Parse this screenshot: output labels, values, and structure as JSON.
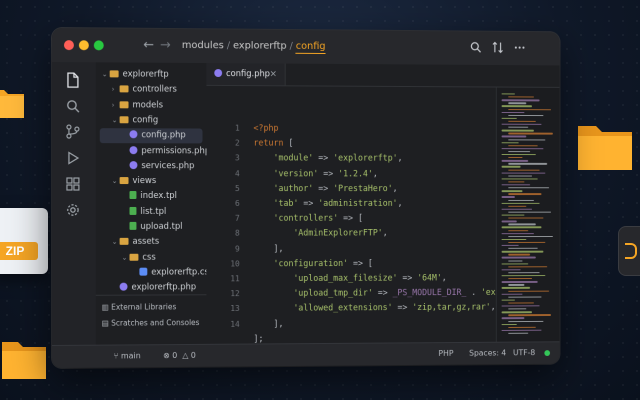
{
  "titlebar": {
    "breadcrumb": [
      "modules",
      "explorerftp",
      "config"
    ],
    "separator": "/"
  },
  "sidebar": {
    "items": [
      {
        "label": "explorerftp",
        "kind": "folder",
        "depth": 0,
        "open": true
      },
      {
        "label": "controllers",
        "kind": "folder",
        "depth": 1,
        "open": false
      },
      {
        "label": "models",
        "kind": "folder",
        "depth": 1,
        "open": false
      },
      {
        "label": "config",
        "kind": "folder",
        "depth": 1,
        "open": true
      },
      {
        "label": "config.php",
        "kind": "php",
        "depth": 2,
        "selected": true
      },
      {
        "label": "permissions.php",
        "kind": "php",
        "depth": 2
      },
      {
        "label": "services.php",
        "kind": "php",
        "depth": 2
      },
      {
        "label": "views",
        "kind": "folder",
        "depth": 1,
        "open": true
      },
      {
        "label": "index.tpl",
        "kind": "tpl",
        "depth": 2
      },
      {
        "label": "list.tpl",
        "kind": "tpl",
        "depth": 2
      },
      {
        "label": "upload.tpl",
        "kind": "tpl",
        "depth": 2
      },
      {
        "label": "assets",
        "kind": "folder",
        "depth": 1,
        "open": true
      },
      {
        "label": "css",
        "kind": "folder",
        "depth": 2,
        "open": true
      },
      {
        "label": "explorerftp.css",
        "kind": "css",
        "depth": 3
      },
      {
        "label": "explorerftp.php",
        "kind": "php",
        "depth": 1
      }
    ],
    "footer": {
      "external_libraries": "External Libraries",
      "scratches": "Scratches and Consoles"
    }
  },
  "editor": {
    "tab_label": "config.php",
    "tab_close": "×",
    "line_numbers": [
      "1",
      "2",
      "3",
      "4",
      "5",
      "6",
      "7",
      "8",
      "9",
      "10",
      "11",
      "12",
      "13",
      "14"
    ],
    "code": [
      [
        {
          "t": "<?php",
          "c": "kw"
        }
      ],
      [
        {
          "t": "return",
          "c": "kw"
        },
        {
          "t": " [",
          "c": "op"
        }
      ],
      [
        {
          "t": "    'module'",
          "c": "str"
        },
        {
          "t": " => ",
          "c": "op"
        },
        {
          "t": "'explorerftp'",
          "c": "str"
        },
        {
          "t": ",",
          "c": "op"
        }
      ],
      [
        {
          "t": "    'version'",
          "c": "str"
        },
        {
          "t": " => ",
          "c": "op"
        },
        {
          "t": "'1.2.4'",
          "c": "str"
        },
        {
          "t": ",",
          "c": "op"
        }
      ],
      [
        {
          "t": "    'author'",
          "c": "str"
        },
        {
          "t": " => ",
          "c": "op"
        },
        {
          "t": "'PrestaHero'",
          "c": "str"
        },
        {
          "t": ",",
          "c": "op"
        }
      ],
      [
        {
          "t": "    'tab'",
          "c": "str"
        },
        {
          "t": " => ",
          "c": "op"
        },
        {
          "t": "'administration'",
          "c": "str"
        },
        {
          "t": ",",
          "c": "op"
        }
      ],
      [
        {
          "t": "    'controllers'",
          "c": "str"
        },
        {
          "t": " => [",
          "c": "op"
        }
      ],
      [
        {
          "t": "        'AdminExplorerFTP'",
          "c": "str"
        },
        {
          "t": ",",
          "c": "op"
        }
      ],
      [
        {
          "t": "    ],",
          "c": "op"
        }
      ],
      [
        {
          "t": "    'configuration'",
          "c": "str"
        },
        {
          "t": " => [",
          "c": "op"
        }
      ],
      [
        {
          "t": "        'upload_max_filesize'",
          "c": "str"
        },
        {
          "t": " => ",
          "c": "op"
        },
        {
          "t": "'64M'",
          "c": "str"
        },
        {
          "t": ",",
          "c": "op"
        }
      ],
      [
        {
          "t": "        'upload_tmp_dir'",
          "c": "str"
        },
        {
          "t": " => ",
          "c": "op"
        },
        {
          "t": "_PS_MODULE_DIR_",
          "c": "const"
        },
        {
          "t": " . ",
          "c": "op"
        },
        {
          "t": "'explorerftp/tmp/'",
          "c": "str"
        },
        {
          "t": ",",
          "c": "op"
        }
      ],
      [
        {
          "t": "        'allowed_extensions'",
          "c": "str"
        },
        {
          "t": " => ",
          "c": "op"
        },
        {
          "t": "'zip,tar,gz,rar'",
          "c": "str"
        },
        {
          "t": ",",
          "c": "op"
        }
      ],
      [
        {
          "t": "    ],",
          "c": "op"
        }
      ],
      [
        {
          "t": "];",
          "c": "op"
        }
      ]
    ]
  },
  "statusbar": {
    "branch": "main",
    "errors": "0",
    "warnings": "0",
    "language": "PHP",
    "indent": "Spaces: 4",
    "encoding": "UTF-8"
  },
  "decor": {
    "zip_label": "ZIP"
  },
  "colors": {
    "accent": "#f5a524",
    "background": "#0f1828",
    "editor": "#1e1f22",
    "folder": "#f5a524"
  },
  "icons": [
    "files-icon",
    "search-icon",
    "source-control-icon",
    "run-icon",
    "extensions-icon",
    "settings-icon"
  ]
}
